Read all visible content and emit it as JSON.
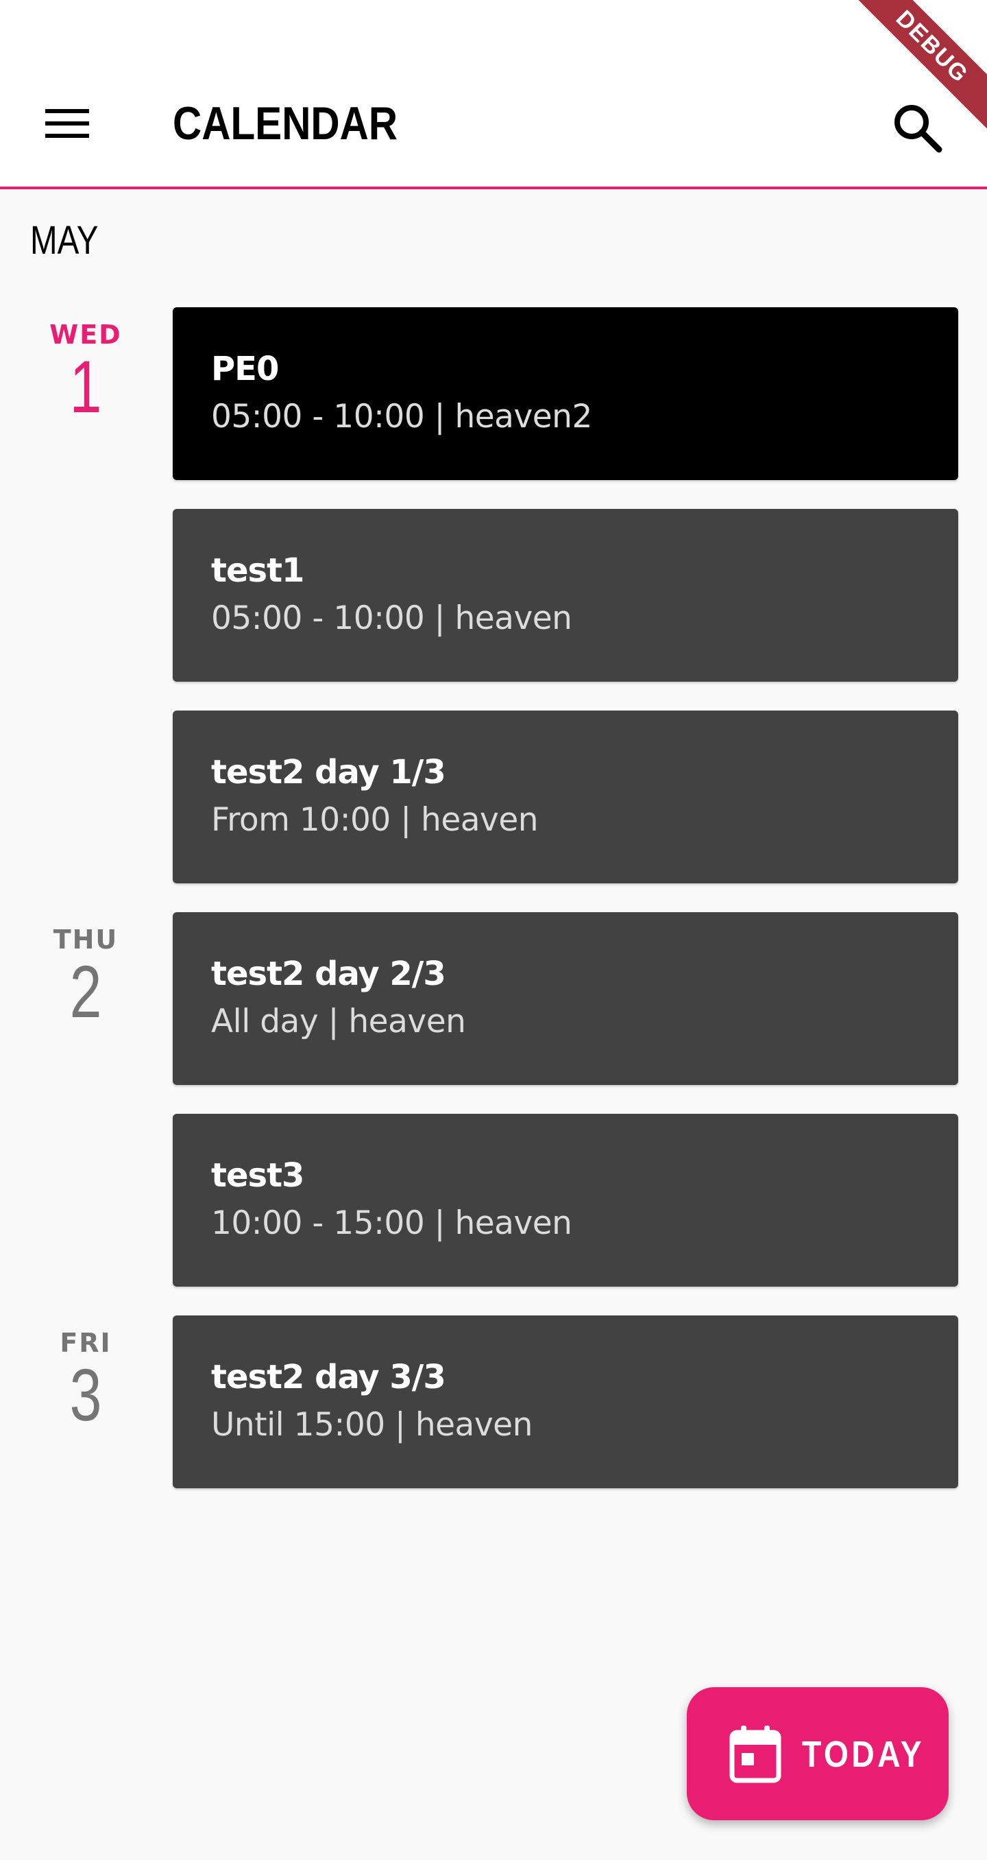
{
  "appbar": {
    "title": "CALENDAR",
    "menu_icon": "menu-icon",
    "search_icon": "search-icon",
    "debug_banner": "DEBUG",
    "accent_color": "#e91e73"
  },
  "month": "MAY",
  "days": [
    {
      "dow": "WED",
      "num": "1"
    },
    {
      "dow": "THU",
      "num": "2"
    },
    {
      "dow": "FRI",
      "num": "3"
    }
  ],
  "events": [
    {
      "title": "PE0",
      "subtitle": "05:00 - 10:00 | heaven2"
    },
    {
      "title": "test1",
      "subtitle": "05:00 - 10:00 | heaven"
    },
    {
      "title": "test2 day 1/3",
      "subtitle": "From 10:00 | heaven"
    },
    {
      "title": "test2 day 2/3",
      "subtitle": "All day | heaven"
    },
    {
      "title": "test3",
      "subtitle": "10:00 - 15:00 | heaven"
    },
    {
      "title": "test2 day 3/3",
      "subtitle": "Until 15:00 | heaven"
    }
  ],
  "fab": {
    "label": "TODAY",
    "icon": "calendar-icon"
  }
}
